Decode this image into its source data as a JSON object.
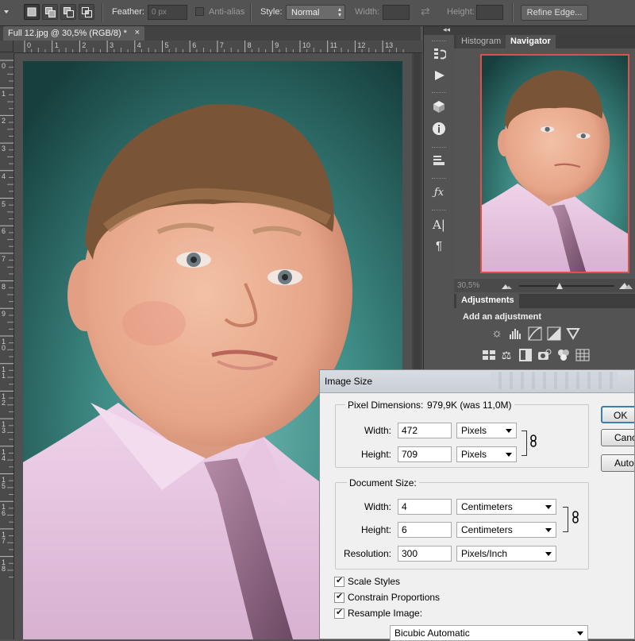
{
  "options_bar": {
    "feather_label": "Feather:",
    "feather_value": "0 px",
    "anti_alias_label": "Anti-alias",
    "style_label": "Style:",
    "style_value": "Normal",
    "width_label": "Width:",
    "height_label": "Height:",
    "refine_edge_label": "Refine Edge..."
  },
  "document": {
    "tab_title": "Full 12.jpg @ 30,5% (RGB/8) *",
    "close_glyph": "×",
    "h_ruler_numbers": [
      "0",
      "1",
      "2",
      "3",
      "4",
      "5",
      "6",
      "7",
      "8",
      "9",
      "10",
      "11",
      "12",
      "13"
    ],
    "v_ruler_numbers": [
      "0",
      "1",
      "2",
      "3",
      "4",
      "5",
      "6",
      "7",
      "8",
      "9",
      "1\n0",
      "1\n1",
      "1\n2",
      "1\n3",
      "1\n4",
      "1\n5",
      "1\n6",
      "1\n7",
      "1\n8"
    ]
  },
  "panels": {
    "collapse_glyph": "◂◂",
    "tabs": [
      {
        "label": "Histogram",
        "active": false
      },
      {
        "label": "Navigator",
        "active": true
      }
    ],
    "navigator_zoom": "30,5%",
    "adjustments_tab": "Adjustments",
    "add_adjustment_label": "Add an adjustment"
  },
  "dialog": {
    "title": "Image Size",
    "pixel_dimensions_label": "Pixel Dimensions:",
    "pixel_dimensions_value": "979,9K (was 11,0M)",
    "px_width_label": "Width:",
    "px_width_value": "472",
    "px_width_unit": "Pixels",
    "px_height_label": "Height:",
    "px_height_value": "709",
    "px_height_unit": "Pixels",
    "document_size_label": "Document Size:",
    "doc_width_label": "Width:",
    "doc_width_value": "4",
    "doc_width_unit": "Centimeters",
    "doc_height_label": "Height:",
    "doc_height_value": "6",
    "doc_height_unit": "Centimeters",
    "resolution_label": "Resolution:",
    "resolution_value": "300",
    "resolution_unit": "Pixels/Inch",
    "scale_styles": "Scale Styles",
    "constrain_proportions": "Constrain Proportions",
    "resample_image": "Resample Image:",
    "resample_method": "Bicubic Automatic",
    "ok_button": "OK",
    "cancel_button": "Cancel",
    "auto_button": "Auto..."
  },
  "colors": {
    "ui_bg": "#535353",
    "photo_teal": "#2e7a74",
    "navigator_frame": "#e0504a",
    "dialog_bg": "#f0f0f0"
  }
}
